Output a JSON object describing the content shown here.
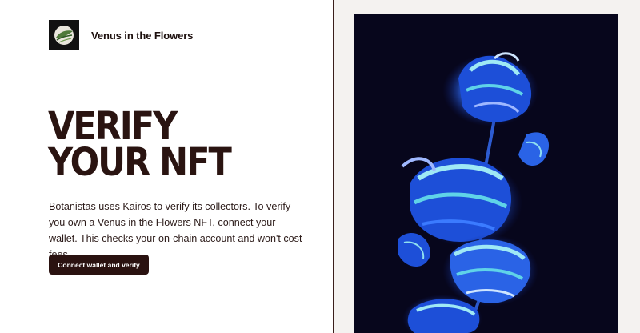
{
  "brand": {
    "name": "Venus in the Flowers",
    "logo_icon": "leaf-orb-logo"
  },
  "main": {
    "heading_line1": "VERIFY",
    "heading_line2": "YOUR NFT",
    "description": "Botanistas uses Kairos to verify its collectors. To verify you own a Venus in the Flowers NFT, connect your wallet. This checks your on-chain account and won't cost fees.",
    "cta_label": "Connect wallet and verify"
  },
  "artwork": {
    "icon": "blue-flower-artwork",
    "background": "#07061c",
    "petal_colors": [
      "#1d4fd8",
      "#3b7bff",
      "#5fd3e8",
      "#9fb8ff"
    ]
  },
  "colors": {
    "heading": "#2a1411",
    "button_bg": "#2a1210",
    "divider": "#3a1e1b",
    "right_panel_bg": "#f4f2f0"
  }
}
